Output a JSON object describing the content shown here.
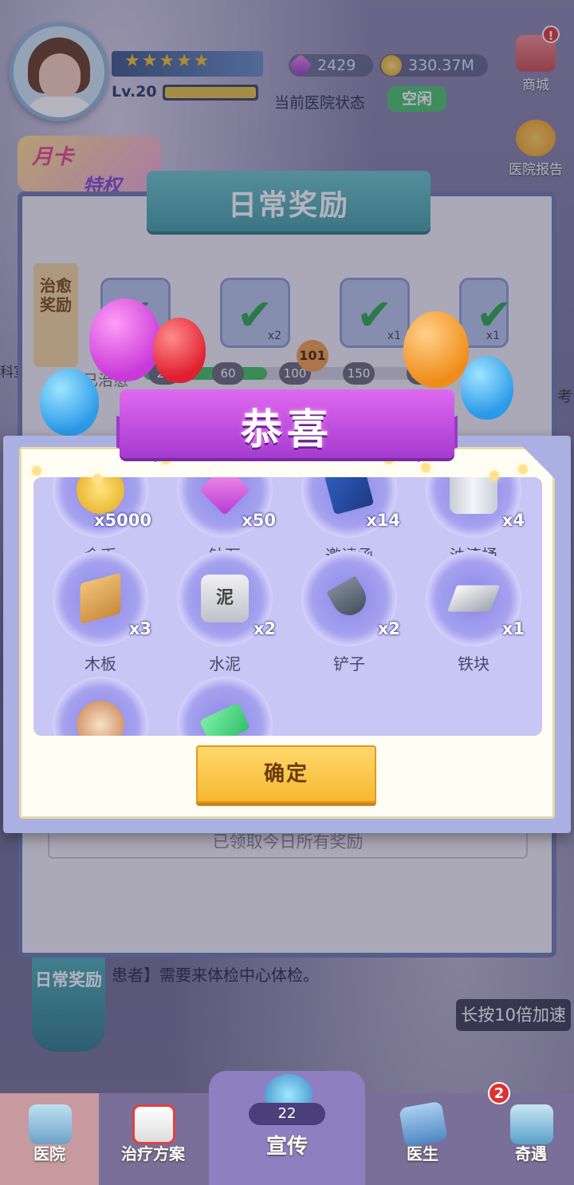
{
  "hud": {
    "level": "Lv.20",
    "stars": "★★★★★",
    "gems": "2429",
    "coins": "330.37M",
    "status_label": "当前医院状态",
    "status_value": "空闲"
  },
  "side_buttons": {
    "shop": "商城",
    "report": "医院报告",
    "shop_badge": "!"
  },
  "month_card": {
    "line1": "月卡",
    "line2": "特权"
  },
  "daily_panel": {
    "title": "日常奖励",
    "tag": "治愈奖励",
    "slot_counts": [
      "",
      "x2",
      "x1",
      "x1"
    ],
    "left_label": "已治愈",
    "progress_point": "101",
    "milestones": [
      "20",
      "60",
      "100",
      "150",
      "200"
    ],
    "progress_fraction": 0.42,
    "claimed_all": "已领取今日所有奖励",
    "button": "日常奖励"
  },
  "background_texts": {
    "notice": "患者】需要来体检中心体检。",
    "speed_tip": "长按10倍加速",
    "left_edge": "科室",
    "right_edge": "考"
  },
  "popup": {
    "title": "恭喜",
    "confirm": "确定",
    "items": [
      {
        "name": "金币",
        "qty": "x5000",
        "icon": "coin-icon"
      },
      {
        "name": "钻石",
        "qty": "x50",
        "icon": "gem-icon"
      },
      {
        "name": "邀请函",
        "qty": "x14",
        "icon": "invitation-icon"
      },
      {
        "name": "油漆桶",
        "qty": "x4",
        "icon": "paint-bucket-icon"
      },
      {
        "name": "木板",
        "qty": "x3",
        "icon": "wood-plank-icon"
      },
      {
        "name": "水泥",
        "qty": "x2",
        "icon": "cement-icon",
        "icon_text": "泥"
      },
      {
        "name": "铲子",
        "qty": "x2",
        "icon": "shovel-icon"
      },
      {
        "name": "铁块",
        "qty": "x1",
        "icon": "iron-block-icon"
      },
      {
        "name": "",
        "qty": "",
        "icon": "cake-icon"
      },
      {
        "name": "",
        "qty": "",
        "icon": "ticket-icon"
      }
    ]
  },
  "bottom_nav": {
    "hospital": "医院",
    "treatment": "治疗方案",
    "promotion": "宣传",
    "promotion_count": "22",
    "doctor": "医生",
    "wonder": "奇遇",
    "wonder_badge": "2"
  }
}
